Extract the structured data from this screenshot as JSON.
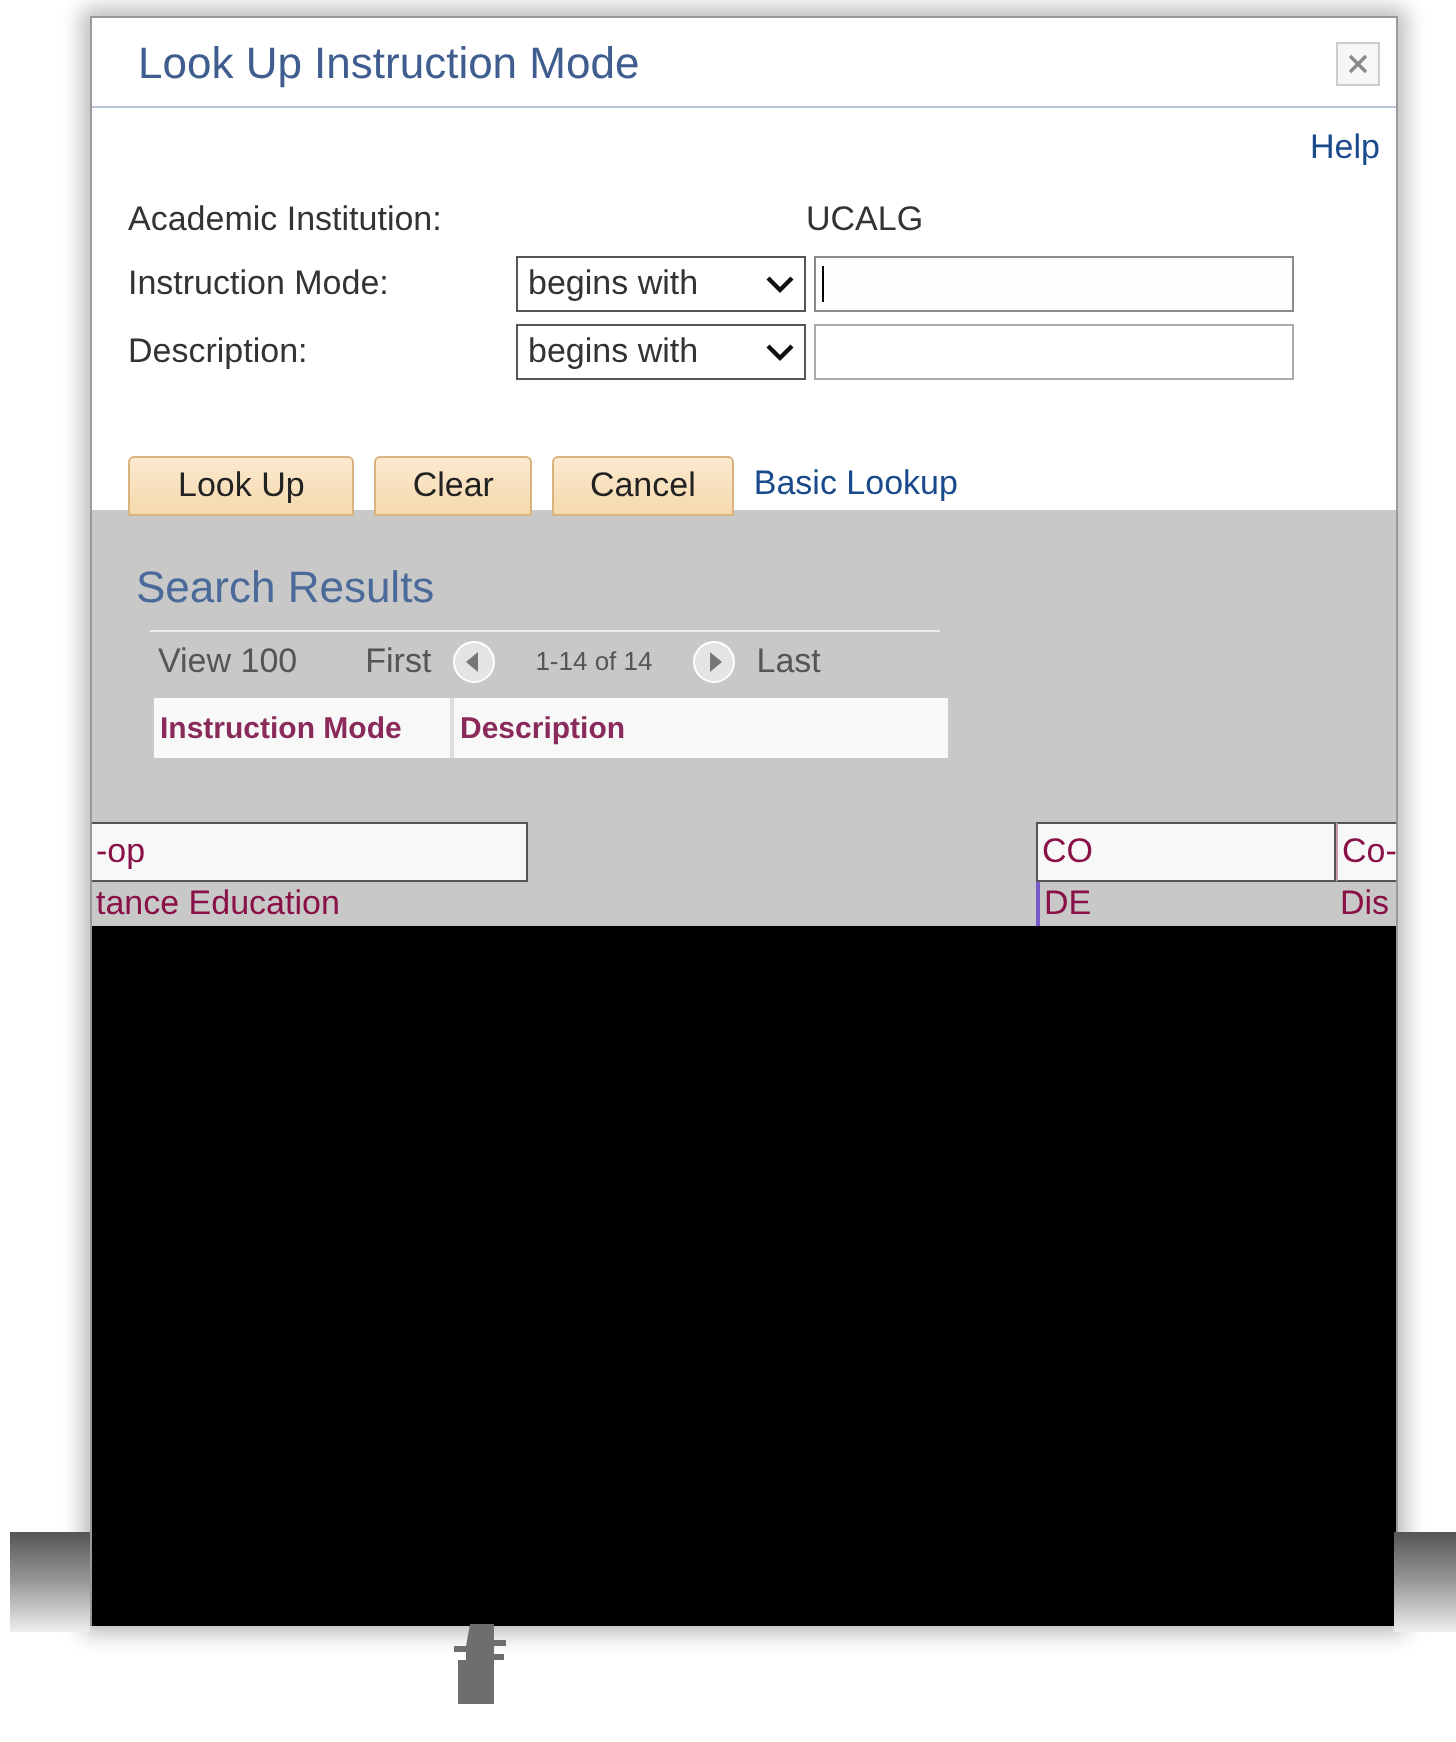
{
  "dialog": {
    "title": "Look Up Instruction Mode",
    "help": "Help"
  },
  "fields": [
    {
      "kind": "static",
      "label": "Academic Institution:",
      "value": "UCALG"
    },
    {
      "kind": "search",
      "label": "Instruction Mode:",
      "operator": "begins with",
      "focused": true
    },
    {
      "kind": "search",
      "label": "Description:",
      "operator": "begins with",
      "focused": false
    }
  ],
  "buttons": [
    "Look Up",
    "Clear",
    "Cancel"
  ],
  "basic_lookup": "Basic Lookup",
  "results": {
    "title": "Search Results",
    "view": "View 100",
    "first": "First",
    "range": "1-14 of 14",
    "last": "Last",
    "columns": [
      "Instruction Mode",
      "Description"
    ],
    "rows": [
      {
        "left": "-op",
        "code": "CO",
        "desc": "Co-",
        "selected": true
      },
      {
        "left": "tance Education",
        "code": "DE",
        "desc": "Dis",
        "selected": false
      }
    ]
  }
}
